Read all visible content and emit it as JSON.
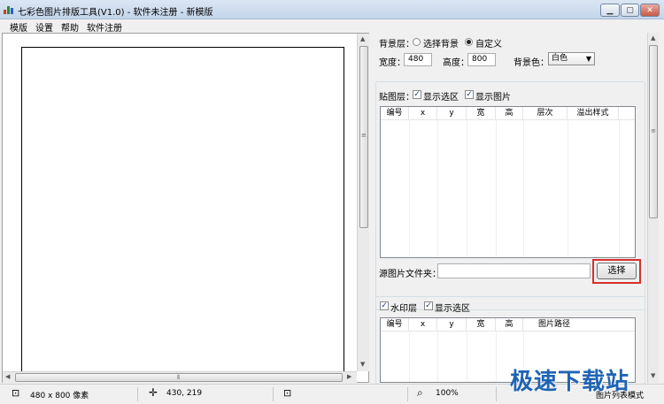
{
  "window": {
    "title": "七彩色图片排版工具(V1.0) - 软件未注册 - 新模版",
    "app_icon": "bar-chart-icon",
    "controls": {
      "minimize": "▁",
      "maximize": "▢",
      "close": "✕"
    }
  },
  "menu": [
    "模版",
    "设置",
    "帮助",
    "软件注册"
  ],
  "background_layer": {
    "label": "背景层：",
    "options": [
      "选择背景",
      "自定义"
    ],
    "selected_option": "自定义",
    "width_label": "宽度：",
    "width_value": "480",
    "height_label": "高度：",
    "height_value": "800",
    "color_label": "背景色：",
    "color_value": "白色"
  },
  "paste_layer": {
    "label": "贴图层：",
    "show_selection_label": "显示选区",
    "show_selection_checked": true,
    "show_image_label": "显示图片",
    "show_image_checked": true,
    "columns": [
      "编号",
      "x",
      "y",
      "宽",
      "高",
      "层次",
      "溢出样式"
    ],
    "source_folder_label": "源图片文件夹：",
    "source_folder_value": "",
    "select_button_label": "选择"
  },
  "watermark_layer": {
    "enabled_label": "水印层",
    "enabled_checked": true,
    "show_selection_label": "显示选区",
    "show_selection_checked": true,
    "columns": [
      "编号",
      "x",
      "y",
      "宽",
      "高",
      "图片路径"
    ]
  },
  "statusbar": {
    "size_text": "480 x 800 像素",
    "coords_text": "430, 219",
    "zoom_text": "100%",
    "mode_text": "图片列表模式"
  },
  "overlay_watermark": "极速下载站",
  "colors": {
    "highlight_outline": "#d9302c",
    "watermark_text": "#1f64b5"
  }
}
